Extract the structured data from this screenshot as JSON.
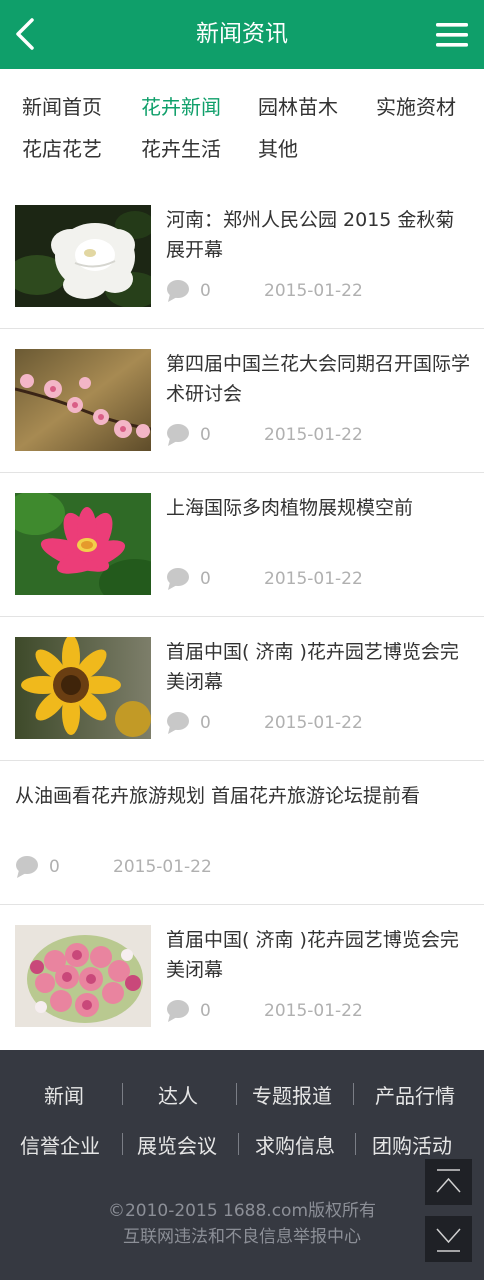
{
  "header": {
    "title": "新闻资讯",
    "back_icon": "chevron-left-icon",
    "menu_icon": "hamburger-icon",
    "color": "#0f9f6a"
  },
  "categories": [
    {
      "label": "新闻首页",
      "active": false
    },
    {
      "label": "花卉新闻",
      "active": true
    },
    {
      "label": "园林苗木",
      "active": false
    },
    {
      "label": "实施资材",
      "active": false
    },
    {
      "label": "花店花艺",
      "active": false
    },
    {
      "label": "花卉生活",
      "active": false
    },
    {
      "label": "其他",
      "active": false
    }
  ],
  "news": [
    {
      "title": "河南：郑州人民公园 2015 金秋菊展开幕",
      "comments": "0",
      "date": "2015-01-22",
      "image": "white-peony"
    },
    {
      "title": "第四届中国兰花大会同期召开国际学术研讨会",
      "comments": "0",
      "date": "2015-01-22",
      "image": "plum-blossom"
    },
    {
      "title": "上海国际多肉植物展规模空前",
      "comments": "0",
      "date": "2015-01-22",
      "image": "lotus"
    },
    {
      "title": "首届中国( 济南 )花卉园艺博览会完美闭幕",
      "comments": "0",
      "date": "2015-01-22",
      "image": "sunflower"
    },
    {
      "title": "从油画看花卉旅游规划 首届花卉旅游论坛提前看",
      "comments": "0",
      "date": "2015-01-22",
      "image": ""
    },
    {
      "title": "首届中国( 济南 )花卉园艺博览会完美闭幕",
      "comments": "0",
      "date": "2015-01-22",
      "image": "rose-bouquet"
    }
  ],
  "footer": {
    "links": [
      "新闻",
      "达人",
      "专题报道",
      "产品行情",
      "信誉企业",
      "展览会议",
      "求购信息",
      "团购活动"
    ],
    "copyright": "©2010-2015 1688.com版权所有",
    "report": "互联网违法和不良信息举报中心",
    "top_icon": "arrow-up-icon",
    "bottom_icon": "arrow-down-icon"
  }
}
